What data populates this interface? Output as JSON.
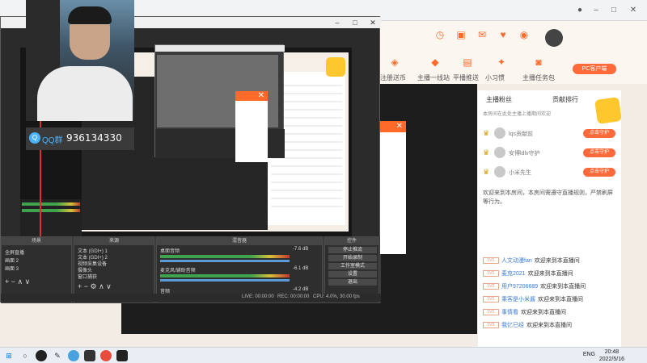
{
  "qq": {
    "label": "QQ群",
    "number": "936134330"
  },
  "site": {
    "nav": [
      {
        "label": "注册送币",
        "icon": "gift-icon"
      },
      {
        "label": "主播一线站",
        "icon": "cup-icon"
      },
      {
        "label": "平播推送",
        "icon": "tv-icon"
      },
      {
        "label": "小习惯",
        "icon": "star-icon"
      },
      {
        "label": "主播任务包",
        "icon": "bag-icon"
      }
    ],
    "pc_button": "PC客户端"
  },
  "chat": {
    "tab_fans": "主播粉丝",
    "tab_rank": "贡献排行",
    "intro": "本房间在此处主播上播期间欢迎",
    "ranks": [
      {
        "name": "lqs贡献前",
        "badge": "点击守护"
      },
      {
        "name": "安博ldlv守护",
        "badge": "点击守护"
      },
      {
        "name": "小米先生",
        "badge": "点击守护"
      }
    ],
    "notice": "欢迎来到本房间，本房间需遵守直播规则，严禁刷屏等行为。",
    "messages": [
      {
        "level": "LV1",
        "user": "人文动漫fan",
        "text": "欢迎来到本直播间"
      },
      {
        "level": "LV1",
        "user": "麦克2021",
        "text": "欢迎来到本直播间"
      },
      {
        "level": "LV2",
        "user": "用户97206689",
        "text": "欢迎来到本直播间"
      },
      {
        "level": "LV1",
        "user": "乘客是小米酱",
        "text": "欢迎来到本直播间"
      },
      {
        "level": "LV1",
        "user": "事情看",
        "text": "欢迎来到本直播间"
      },
      {
        "level": "LV3",
        "user": "我忆已经",
        "text": "欢迎来到本直播间"
      }
    ]
  },
  "obs": {
    "docks": {
      "scenes": "场景",
      "sources": "来源",
      "mixer": "混音器",
      "controls": "控件"
    },
    "scene_items": [
      "全屏直播",
      "画面 2",
      "画面 3"
    ],
    "source_items": [
      "文本 (GDI+) 1",
      "文本 (GDI+) 2",
      "视频采集设备",
      "摄像头",
      "窗口捕获"
    ],
    "mixer_tracks": [
      {
        "name": "桌面音频",
        "db": "-7.6 dB"
      },
      {
        "name": "麦克风/辅助音频",
        "db": "-6.1 dB"
      },
      {
        "name": "音频",
        "db": "-4.2 dB"
      }
    ],
    "controls": [
      "停止推流",
      "开始录制",
      "工作室模式",
      "设置",
      "退出"
    ],
    "status": {
      "live": "LIVE: 00:00:00",
      "rec": "REC: 00:00:00",
      "cpu": "CPU: 4.0%, 30.00 fps"
    }
  },
  "taskbar": {
    "lang": "ENG",
    "time": "20:48",
    "date": "2022/5/16"
  }
}
